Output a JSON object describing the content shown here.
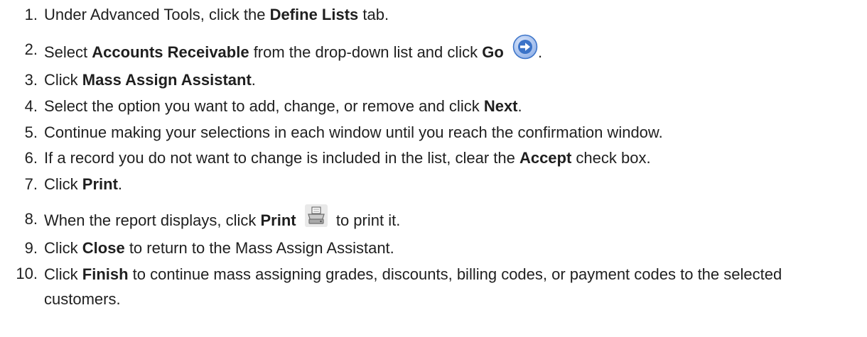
{
  "steps": [
    {
      "num": "1.",
      "parts": [
        "Under Advanced Tools, click the ",
        "Define Lists",
        " tab."
      ]
    },
    {
      "num": "2.",
      "parts": [
        "Select ",
        "Accounts Receivable",
        " from the drop-down list and click ",
        "Go",
        " ",
        "."
      ],
      "icon": "go-arrow-icon"
    },
    {
      "num": "3.",
      "parts": [
        "Click ",
        "Mass Assign Assistant",
        "."
      ]
    },
    {
      "num": "4.",
      "parts": [
        "Select the option you want to add, change, or remove and click ",
        "Next",
        "."
      ]
    },
    {
      "num": "5.",
      "parts": [
        "Continue making your selections in each window until you reach the confirmation window."
      ]
    },
    {
      "num": "6.",
      "parts": [
        "If a record you do not want to change is included in the list, clear the ",
        "Accept",
        " check box."
      ]
    },
    {
      "num": "7.",
      "parts": [
        "Click ",
        "Print",
        "."
      ]
    },
    {
      "num": "8.",
      "parts": [
        "When the report displays, click ",
        "Print",
        " ",
        " to print it."
      ],
      "icon": "printer-icon"
    },
    {
      "num": "9.",
      "parts": [
        "Click ",
        "Close",
        " to return to the Mass Assign Assistant."
      ]
    },
    {
      "num": "10.",
      "parts": [
        "Click ",
        "Finish",
        " to continue mass assigning grades, discounts, billing codes, or payment codes to the selected customers."
      ]
    }
  ],
  "icons": {
    "go": "go-arrow-icon",
    "print": "printer-icon"
  },
  "colors": {
    "text": "#1f1f1f",
    "go_blue": "#3b73c8"
  }
}
